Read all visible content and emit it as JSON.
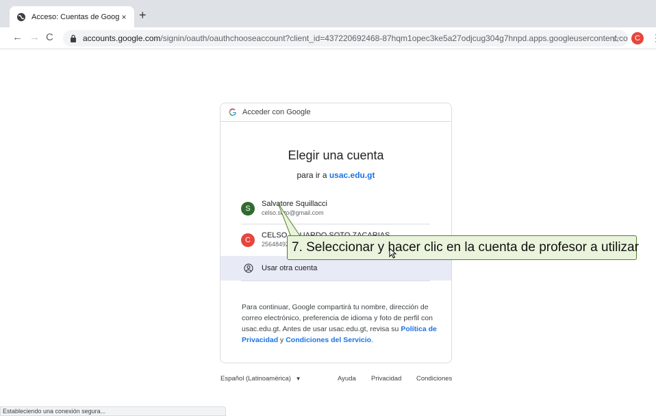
{
  "browser": {
    "tab_title": "Acceso: Cuentas de Google",
    "tab_close": "×",
    "new_tab": "+",
    "url_host": "accounts.google.com",
    "url_path": "/signin/oauth/oauthchooseaccount?client_id=437220692468-87hqm1opec3ke5a27odjcug304g7hnpd.apps.googleusercontent.co...",
    "profile_initial": "C",
    "status_text": "Estableciendo una conexión segura..."
  },
  "card": {
    "header": "Acceder con Google",
    "title": "Elegir una cuenta",
    "subtitle_prefix": "para ir a ",
    "subtitle_domain": "usac.edu.gt",
    "accounts": [
      {
        "initial": "S",
        "name": "Salvatore Squillacci",
        "email": "celso.soto@gmail.com",
        "color": "#2e6b2f"
      },
      {
        "initial": "C",
        "name": "CELSO EDUARDO SOTO ZACARIAS",
        "email": "2564849201@usac.edu.gt",
        "color": "#e8453c"
      }
    ],
    "other_account": "Usar otra cuenta",
    "disclaimer_text": "Para continuar, Google compartirá tu nombre, dirección de correo electrónico, preferencia de idioma y foto de perfil con usac.edu.gt. Antes de usar usac.edu.gt, revisa su",
    "privacy_link": "Política de Privacidad",
    "and_word": "y",
    "terms_link": "Condiciones del Servicio",
    "period": "."
  },
  "footer": {
    "language": "Español (Latinoamérica)",
    "help": "Ayuda",
    "privacy": "Privacidad",
    "terms": "Condiciones"
  },
  "annotation": {
    "callout_text": "7. Seleccionar y hacer clic en la cuenta de profesor a utilizar"
  },
  "colors": {
    "accent": "#1a73e8",
    "callout_bg": "#eaf4dc",
    "callout_border": "#4f7a2a"
  }
}
